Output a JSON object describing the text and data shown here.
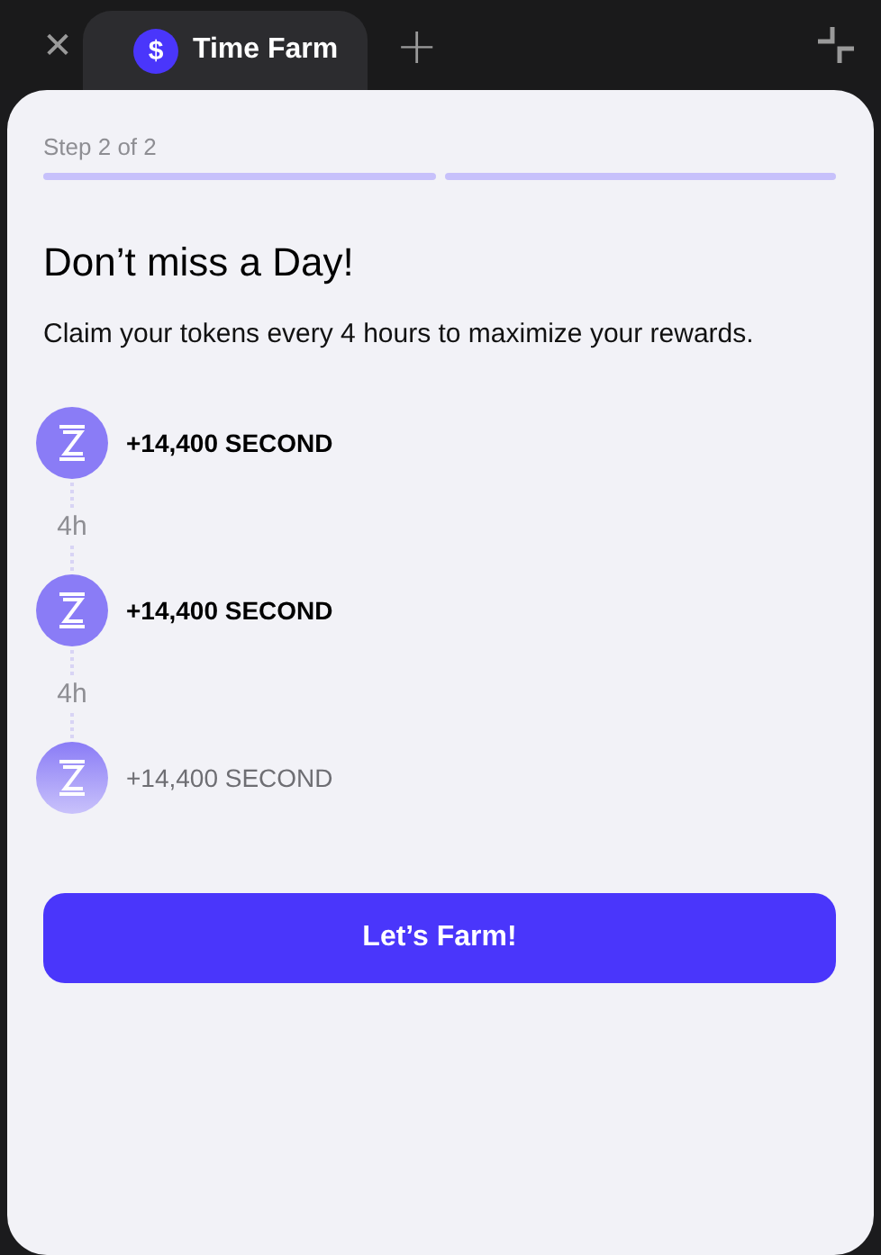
{
  "header": {
    "close": "✕",
    "tab": {
      "icon": "$",
      "title": "Time Farm",
      "selected": true
    },
    "add": "+"
  },
  "stepper": {
    "label": "Step 2 of 2",
    "steps": [
      {
        "done": true
      },
      {
        "done": true
      }
    ]
  },
  "title": "Don’t miss a Day!",
  "description": "Claim your tokens every 4 hours to maximize your rewards.",
  "rewards": [
    {
      "amount": "+14,400 SECOND",
      "faded": false,
      "interval": "4h"
    },
    {
      "amount": "+14,400 SECOND",
      "faded": false,
      "interval": "4h"
    },
    {
      "amount": "+14,400 SECOND",
      "faded": true
    }
  ],
  "button": "Let’s Farm!"
}
